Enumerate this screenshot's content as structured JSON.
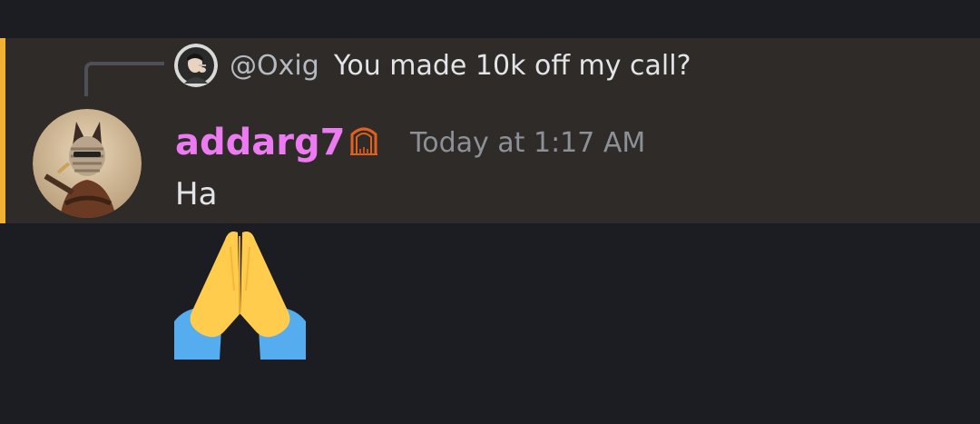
{
  "reply": {
    "author": "@Oxig",
    "text": "You made 10k off my call?"
  },
  "message": {
    "username": "addarg7",
    "timestamp": "Today at 1:17 AM",
    "text": "Ha",
    "emoji": "folded-hands-emoji"
  },
  "icons": {
    "role_icon": "gate-icon",
    "reply_spine": "reply-connector-icon"
  },
  "colors": {
    "background": "#1c1d22",
    "highlight_background": "#2e2b28",
    "highlight_bar": "#f0b232",
    "username": "#ec7af0",
    "timestamp": "#8d9097",
    "message_text": "#e3e4e7"
  }
}
